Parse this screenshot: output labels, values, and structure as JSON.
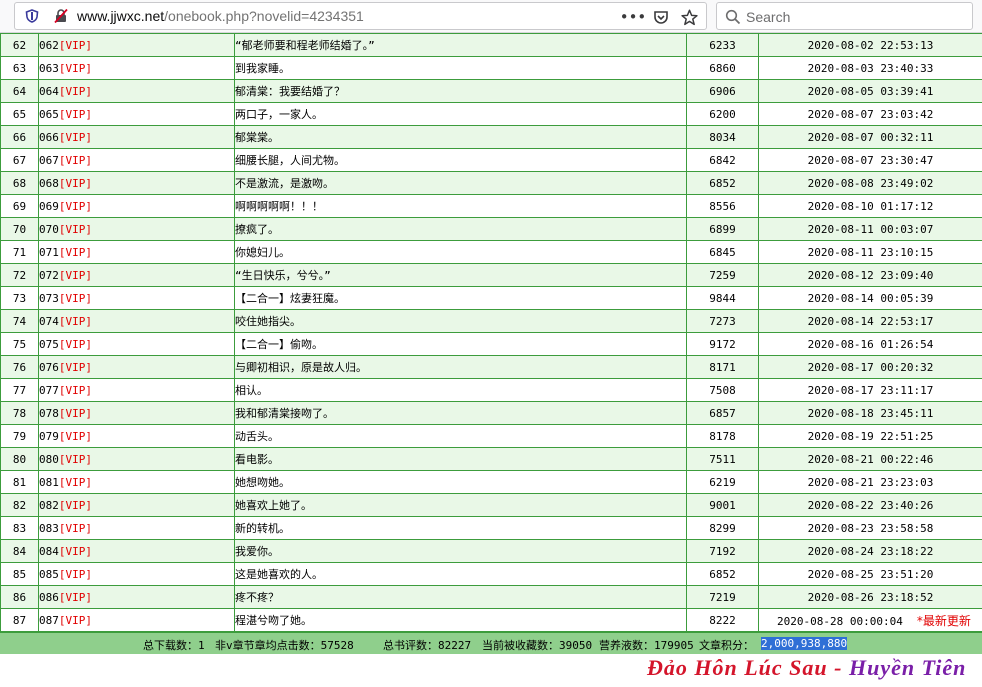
{
  "browser": {
    "url_host": "www.jjwxc.net",
    "url_path": "/onebook.php?novelid=4234351",
    "search_placeholder": "Search"
  },
  "chapters": [
    {
      "no": "62",
      "num": "062",
      "vip": "[VIP]",
      "title": "“郁老师要和程老师结婚了。”",
      "words": "6233",
      "time": "2020-08-02 22:53:13"
    },
    {
      "no": "63",
      "num": "063",
      "vip": "[VIP]",
      "title": "到我家睡。",
      "words": "6860",
      "time": "2020-08-03 23:40:33"
    },
    {
      "no": "64",
      "num": "064",
      "vip": "[VIP]",
      "title": "郁清棠：我要结婚了？",
      "words": "6906",
      "time": "2020-08-05 03:39:41"
    },
    {
      "no": "65",
      "num": "065",
      "vip": "[VIP]",
      "title": "两口子，一家人。",
      "words": "6200",
      "time": "2020-08-07 23:03:42"
    },
    {
      "no": "66",
      "num": "066",
      "vip": "[VIP]",
      "title": "郁棠棠。",
      "words": "8034",
      "time": "2020-08-07 00:32:11"
    },
    {
      "no": "67",
      "num": "067",
      "vip": "[VIP]",
      "title": "细腰长腿，人间尤物。",
      "words": "6842",
      "time": "2020-08-07 23:30:47"
    },
    {
      "no": "68",
      "num": "068",
      "vip": "[VIP]",
      "title": "不是激流，是激吻。",
      "words": "6852",
      "time": "2020-08-08 23:49:02"
    },
    {
      "no": "69",
      "num": "069",
      "vip": "[VIP]",
      "title": "啊啊啊啊啊！！！",
      "words": "8556",
      "time": "2020-08-10 01:17:12"
    },
    {
      "no": "70",
      "num": "070",
      "vip": "[VIP]",
      "title": "撩疯了。",
      "words": "6899",
      "time": "2020-08-11 00:03:07"
    },
    {
      "no": "71",
      "num": "071",
      "vip": "[VIP]",
      "title": "你媳妇儿。",
      "words": "6845",
      "time": "2020-08-11 23:10:15"
    },
    {
      "no": "72",
      "num": "072",
      "vip": "[VIP]",
      "title": "“生日快乐，兮兮。”",
      "words": "7259",
      "time": "2020-08-12 23:09:40"
    },
    {
      "no": "73",
      "num": "073",
      "vip": "[VIP]",
      "title": "【二合一】炫妻狂魔。",
      "words": "9844",
      "time": "2020-08-14 00:05:39"
    },
    {
      "no": "74",
      "num": "074",
      "vip": "[VIP]",
      "title": "咬住她指尖。",
      "words": "7273",
      "time": "2020-08-14 22:53:17"
    },
    {
      "no": "75",
      "num": "075",
      "vip": "[VIP]",
      "title": "【二合一】偷吻。",
      "words": "9172",
      "time": "2020-08-16 01:26:54"
    },
    {
      "no": "76",
      "num": "076",
      "vip": "[VIP]",
      "title": "与卿初相识，原是故人归。",
      "words": "8171",
      "time": "2020-08-17 00:20:32"
    },
    {
      "no": "77",
      "num": "077",
      "vip": "[VIP]",
      "title": "相认。",
      "words": "7508",
      "time": "2020-08-17 23:11:17"
    },
    {
      "no": "78",
      "num": "078",
      "vip": "[VIP]",
      "title": "我和郁清棠接吻了。",
      "words": "6857",
      "time": "2020-08-18 23:45:11"
    },
    {
      "no": "79",
      "num": "079",
      "vip": "[VIP]",
      "title": "动舌头。",
      "words": "8178",
      "time": "2020-08-19 22:51:25"
    },
    {
      "no": "80",
      "num": "080",
      "vip": "[VIP]",
      "title": "看电影。",
      "words": "7511",
      "time": "2020-08-21 00:22:46"
    },
    {
      "no": "81",
      "num": "081",
      "vip": "[VIP]",
      "title": "她想吻她。",
      "words": "6219",
      "time": "2020-08-21 23:23:03"
    },
    {
      "no": "82",
      "num": "082",
      "vip": "[VIP]",
      "title": "她喜欢上她了。",
      "words": "9001",
      "time": "2020-08-22 23:40:26"
    },
    {
      "no": "83",
      "num": "083",
      "vip": "[VIP]",
      "title": "新的转机。",
      "words": "8299",
      "time": "2020-08-23 23:58:58"
    },
    {
      "no": "84",
      "num": "084",
      "vip": "[VIP]",
      "title": "我爱你。",
      "words": "7192",
      "time": "2020-08-24 23:18:22"
    },
    {
      "no": "85",
      "num": "085",
      "vip": "[VIP]",
      "title": "这是她喜欢的人。",
      "words": "6852",
      "time": "2020-08-25 23:51:20"
    },
    {
      "no": "86",
      "num": "086",
      "vip": "[VIP]",
      "title": "疼不疼？",
      "words": "7219",
      "time": "2020-08-26 23:18:52"
    },
    {
      "no": "87",
      "num": "087",
      "vip": "[VIP]",
      "title": "程湛兮吻了她。",
      "words": "8222",
      "time": "2020-08-28 00:00:04",
      "tag": "*最新更新"
    }
  ],
  "stats": {
    "downloads": "总下载数：1",
    "avg_clicks": "非v章节章均点击数：57528",
    "reviews": "总书评数：82227",
    "favorites": "当前被收藏数：39050",
    "nutrient": "营养液数：179905",
    "score_label": "文章积分：",
    "score_value": "2,000,938,880"
  },
  "watermark": {
    "part1": "Đảo Hôn Lúc Sau - ",
    "part2": "Huyền Tiên"
  },
  "colors": {
    "row_odd": "#e9f8e7",
    "row_even": "#ffffff",
    "grid": "#3c9c3c",
    "stats_bar": "#8fcf8c",
    "vip_red": "#e10000",
    "highlight": "#2f6fd6"
  }
}
